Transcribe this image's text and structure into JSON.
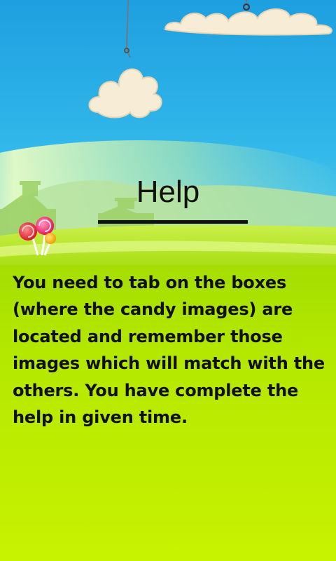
{
  "help": {
    "title": "Help",
    "text": "You need to tab on the boxes (where the candy images) are located and remember those images which will match with the others. You have complete the help in given time."
  },
  "colors": {
    "sky_top": "#26a6e2",
    "sky_bottom": "#4fcbe9",
    "grass": "#8fd400",
    "panel_top": "#a6e000",
    "panel_bottom": "#c6f000",
    "cloud": "#f7ecd6",
    "text": "#111111"
  },
  "icons": {
    "clouds": "hanging-cloud-icon",
    "candy": "lollipop-icon"
  }
}
